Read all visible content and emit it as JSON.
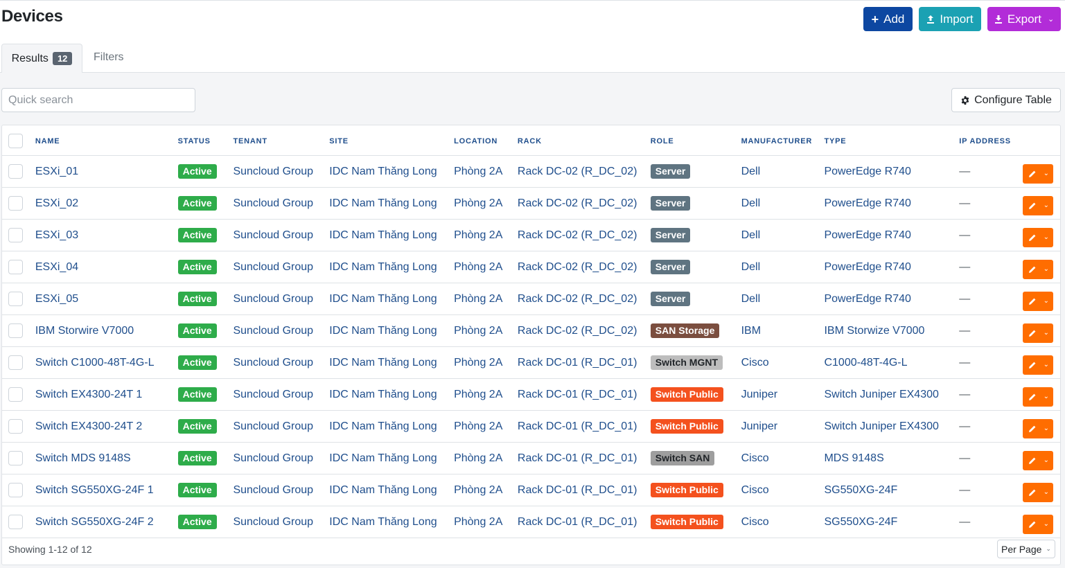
{
  "page": {
    "title": "Devices"
  },
  "toolbar": {
    "add_label": "Add",
    "import_label": "Import",
    "export_label": "Export"
  },
  "tabs": {
    "results_label": "Results",
    "results_count": "12",
    "filters_label": "Filters"
  },
  "search": {
    "placeholder": "Quick search"
  },
  "configure_label": "Configure Table",
  "columns": [
    "NAME",
    "STATUS",
    "TENANT",
    "SITE",
    "LOCATION",
    "RACK",
    "ROLE",
    "MANUFACTURER",
    "TYPE",
    "IP ADDRESS"
  ],
  "role_colors": {
    "Server": "#5f7481",
    "SAN Storage": "#7b4e3f",
    "Switch MGNT": "#bdbdbd",
    "Switch Public": "#f4511e",
    "Switch SAN": "#9e9e9e"
  },
  "role_text_colors": {
    "Switch MGNT": "#212529",
    "Switch SAN": "#212529"
  },
  "rows": [
    {
      "name": "ESXi_01",
      "status": "Active",
      "tenant": "Suncloud Group",
      "site": "IDC Nam Thăng Long",
      "location": "Phòng 2A",
      "rack": "Rack DC-02 (R_DC_02)",
      "role": "Server",
      "manufacturer": "Dell",
      "type": "PowerEdge R740",
      "ip": "—"
    },
    {
      "name": "ESXi_02",
      "status": "Active",
      "tenant": "Suncloud Group",
      "site": "IDC Nam Thăng Long",
      "location": "Phòng 2A",
      "rack": "Rack DC-02 (R_DC_02)",
      "role": "Server",
      "manufacturer": "Dell",
      "type": "PowerEdge R740",
      "ip": "—"
    },
    {
      "name": "ESXi_03",
      "status": "Active",
      "tenant": "Suncloud Group",
      "site": "IDC Nam Thăng Long",
      "location": "Phòng 2A",
      "rack": "Rack DC-02 (R_DC_02)",
      "role": "Server",
      "manufacturer": "Dell",
      "type": "PowerEdge R740",
      "ip": "—"
    },
    {
      "name": "ESXi_04",
      "status": "Active",
      "tenant": "Suncloud Group",
      "site": "IDC Nam Thăng Long",
      "location": "Phòng 2A",
      "rack": "Rack DC-02 (R_DC_02)",
      "role": "Server",
      "manufacturer": "Dell",
      "type": "PowerEdge R740",
      "ip": "—"
    },
    {
      "name": "ESXi_05",
      "status": "Active",
      "tenant": "Suncloud Group",
      "site": "IDC Nam Thăng Long",
      "location": "Phòng 2A",
      "rack": "Rack DC-02 (R_DC_02)",
      "role": "Server",
      "manufacturer": "Dell",
      "type": "PowerEdge R740",
      "ip": "—"
    },
    {
      "name": "IBM Storwire V7000",
      "status": "Active",
      "tenant": "Suncloud Group",
      "site": "IDC Nam Thăng Long",
      "location": "Phòng 2A",
      "rack": "Rack DC-02 (R_DC_02)",
      "role": "SAN Storage",
      "manufacturer": "IBM",
      "type": "IBM Storwize V7000",
      "ip": "—"
    },
    {
      "name": "Switch C1000-48T-4G-L",
      "status": "Active",
      "tenant": "Suncloud Group",
      "site": "IDC Nam Thăng Long",
      "location": "Phòng 2A",
      "rack": "Rack DC-01 (R_DC_01)",
      "role": "Switch MGNT",
      "manufacturer": "Cisco",
      "type": "C1000-48T-4G-L",
      "ip": "—"
    },
    {
      "name": "Switch EX4300-24T 1",
      "status": "Active",
      "tenant": "Suncloud Group",
      "site": "IDC Nam Thăng Long",
      "location": "Phòng 2A",
      "rack": "Rack DC-01 (R_DC_01)",
      "role": "Switch Public",
      "manufacturer": "Juniper",
      "type": "Switch Juniper EX4300",
      "ip": "—"
    },
    {
      "name": "Switch EX4300-24T 2",
      "status": "Active",
      "tenant": "Suncloud Group",
      "site": "IDC Nam Thăng Long",
      "location": "Phòng 2A",
      "rack": "Rack DC-01 (R_DC_01)",
      "role": "Switch Public",
      "manufacturer": "Juniper",
      "type": "Switch Juniper EX4300",
      "ip": "—"
    },
    {
      "name": "Switch MDS 9148S",
      "status": "Active",
      "tenant": "Suncloud Group",
      "site": "IDC Nam Thăng Long",
      "location": "Phòng 2A",
      "rack": "Rack DC-01 (R_DC_01)",
      "role": "Switch SAN",
      "manufacturer": "Cisco",
      "type": "MDS 9148S",
      "ip": "—"
    },
    {
      "name": "Switch SG550XG-24F 1",
      "status": "Active",
      "tenant": "Suncloud Group",
      "site": "IDC Nam Thăng Long",
      "location": "Phòng 2A",
      "rack": "Rack DC-01 (R_DC_01)",
      "role": "Switch Public",
      "manufacturer": "Cisco",
      "type": "SG550XG-24F",
      "ip": "—"
    },
    {
      "name": "Switch SG550XG-24F 2",
      "status": "Active",
      "tenant": "Suncloud Group",
      "site": "IDC Nam Thăng Long",
      "location": "Phòng 2A",
      "rack": "Rack DC-01 (R_DC_01)",
      "role": "Switch Public",
      "manufacturer": "Cisco",
      "type": "SG550XG-24F",
      "ip": "—"
    }
  ],
  "footer": {
    "showing": "Showing 1-12 of 12",
    "per_page_label": "Per Page"
  }
}
